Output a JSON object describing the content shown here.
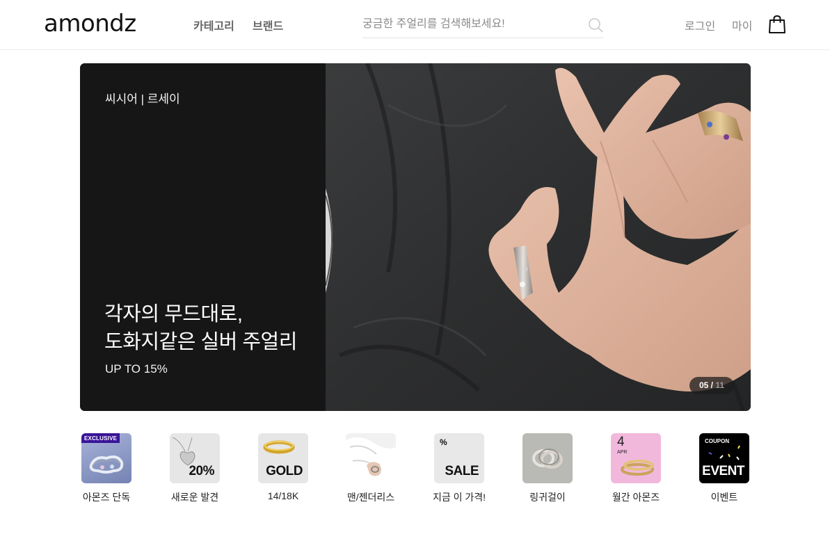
{
  "header": {
    "logo": "amondz",
    "nav": {
      "category": "카테고리",
      "brand": "브랜드"
    },
    "search": {
      "placeholder": "궁금한 주얼리를 검색해보세요!",
      "value": ""
    },
    "util": {
      "login": "로그인",
      "my": "마이"
    }
  },
  "banner": {
    "brand": "씨시어 | 르세이",
    "headline_line1": "각자의 무드대로,",
    "headline_line2": "도화지같은 실버 주얼리",
    "sub": "UP TO 15%",
    "pager_current": "05",
    "pager_sep": " / ",
    "pager_total": "11"
  },
  "categories": [
    {
      "label": "아몬즈 단독",
      "badge": "EXCLUSIVE"
    },
    {
      "label": "새로운 발견",
      "overlay": "20%"
    },
    {
      "label": "14/18K",
      "overlay": "GOLD"
    },
    {
      "label": "맨/젠더리스"
    },
    {
      "label": "지금 이 가격!",
      "overlay": "SALE",
      "corner": "%"
    },
    {
      "label": "링귀걸이"
    },
    {
      "label": "월간 아몬즈",
      "day": "4",
      "month": "APR"
    },
    {
      "label": "이벤트",
      "overlay": "EVENT",
      "corner": "COUPON"
    }
  ],
  "colors": {
    "banner_bg": "#161616",
    "exclusive_badge": "#3a1499",
    "monthly_bg": "#f2b8dc",
    "event_bg": "#000000"
  },
  "icons": [
    "search-icon",
    "shopping-bag-icon"
  ]
}
